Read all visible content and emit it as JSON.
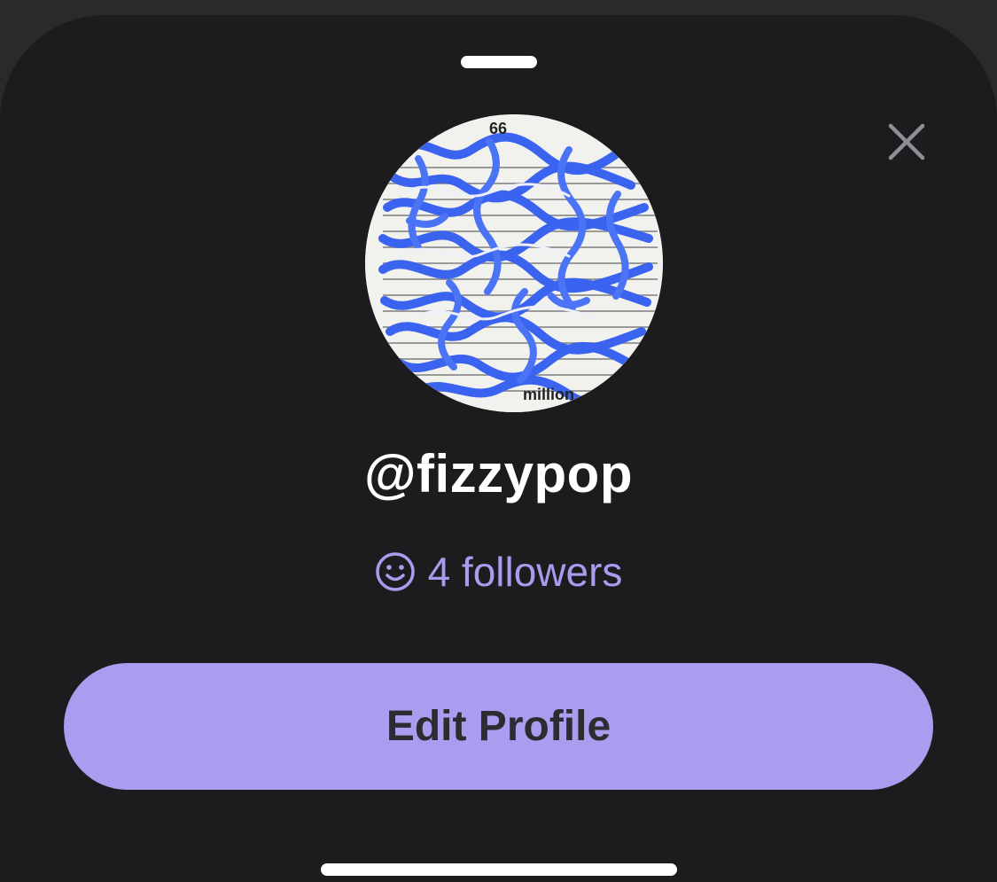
{
  "profile": {
    "username": "@fizzypop",
    "followers_label": "4 followers",
    "follower_count": 4,
    "avatar_text_fragments": [
      "66",
      "million"
    ]
  },
  "actions": {
    "edit_profile_label": "Edit Profile"
  },
  "icons": {
    "close": "close-icon",
    "followers": "smiley-icon"
  },
  "colors": {
    "background": "#2a2a2c",
    "sheet": "#1c1c1e",
    "accent": "#aa9cef",
    "accent_text": "#a99cef",
    "button_text": "#2c2c31",
    "avatar_pattern": "#3a63f0"
  }
}
